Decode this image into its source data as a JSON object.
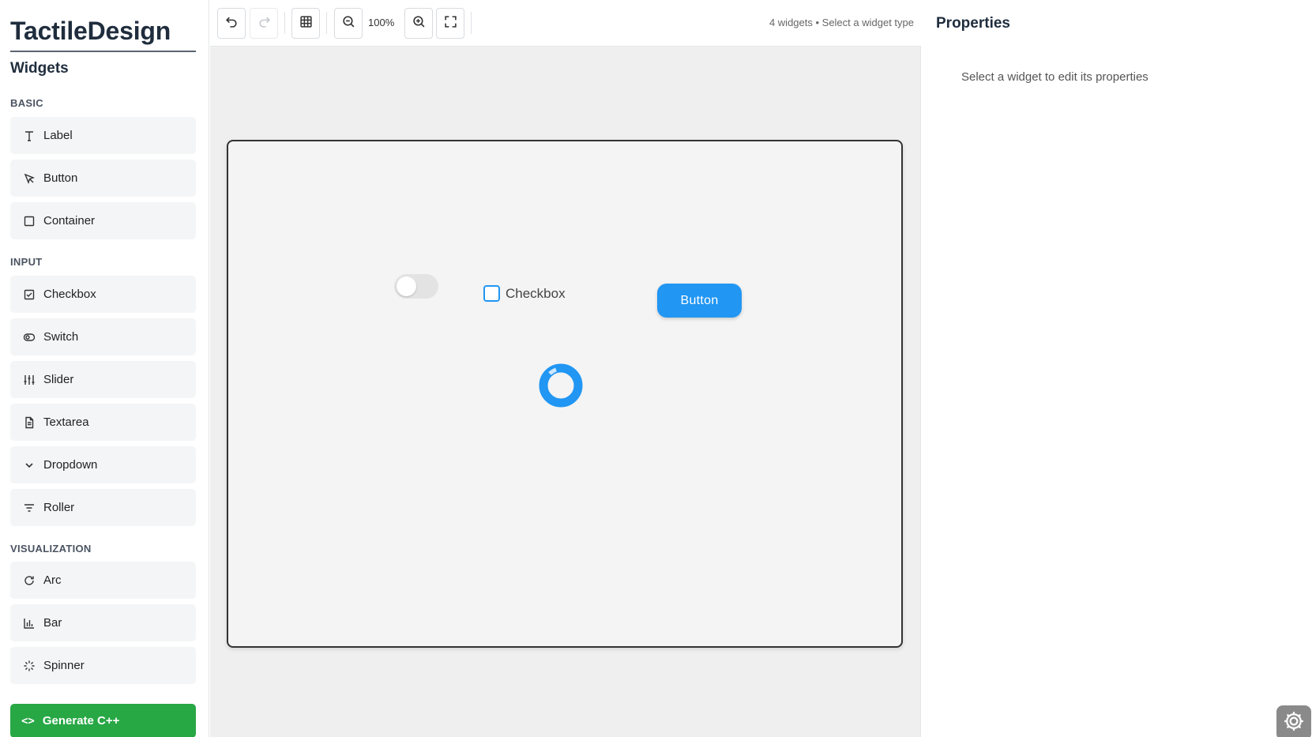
{
  "app": {
    "brand": "TactileDesign"
  },
  "sidebar": {
    "title": "Widgets",
    "categories": [
      {
        "label": "BASIC"
      },
      {
        "label": "INPUT"
      },
      {
        "label": "VISUALIZATION"
      }
    ],
    "items": [
      {
        "label": "Label",
        "icon": "text-icon"
      },
      {
        "label": "Button",
        "icon": "pointer-icon"
      },
      {
        "label": "Container",
        "icon": "square-icon"
      },
      {
        "label": "Checkbox",
        "icon": "checkbox-icon"
      },
      {
        "label": "Switch",
        "icon": "toggle-icon"
      },
      {
        "label": "Slider",
        "icon": "sliders-icon"
      },
      {
        "label": "Textarea",
        "icon": "file-text-icon"
      },
      {
        "label": "Dropdown",
        "icon": "chevron-down-icon"
      },
      {
        "label": "Roller",
        "icon": "filter-lines-icon"
      },
      {
        "label": "Arc",
        "icon": "rotate-icon"
      },
      {
        "label": "Bar",
        "icon": "bar-chart-icon"
      },
      {
        "label": "Spinner",
        "icon": "loader-icon"
      }
    ],
    "generate_label": "Generate C++"
  },
  "toolbar": {
    "zoom": "100%",
    "status": "4 widgets • Select a widget type"
  },
  "canvas": {
    "checkbox_label": "Checkbox",
    "button_label": "Button",
    "switch_state": "off"
  },
  "properties": {
    "title": "Properties",
    "empty_message": "Select a widget to edit its properties"
  },
  "colors": {
    "accent": "#2196f3",
    "generate": "#28a745",
    "brand_text": "#1f2d3d"
  }
}
